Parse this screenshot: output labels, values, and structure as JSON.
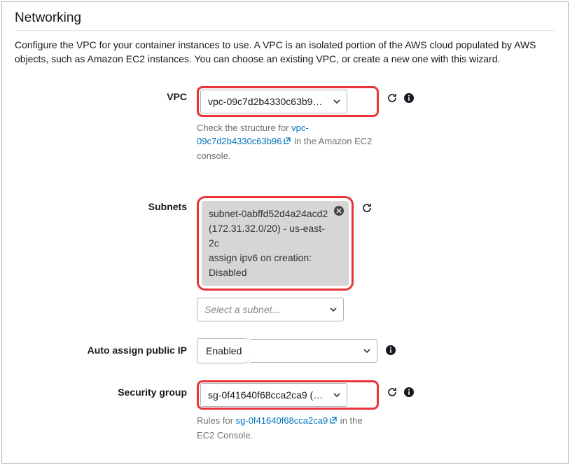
{
  "panel": {
    "title": "Networking",
    "description": "Configure the VPC for your container instances to use. A VPC is an isolated portion of the AWS cloud populated by AWS objects, such as Amazon EC2 instances. You can choose an existing VPC, or create a new one with this wizard."
  },
  "vpc": {
    "label": "VPC",
    "selected": "vpc-09c7d2b4330c63b9…",
    "hint_prefix": "Check the structure for ",
    "hint_link": "vpc-09c7d2b4330c63b96",
    "hint_suffix": " in the Amazon EC2 console."
  },
  "subnets": {
    "label": "Subnets",
    "selected": {
      "id": "subnet-0abffd52d4a24acd2",
      "cidr_az": "(172.31.32.0/20) - us-east-2c",
      "ipv6": "assign ipv6 on creation: Disabled"
    },
    "placeholder": "Select a subnet..."
  },
  "auto_ip": {
    "label": "Auto assign public IP",
    "value": "Enabled"
  },
  "sg": {
    "label": "Security group",
    "selected": "sg-0f41640f68cca2ca9 (…",
    "hint_prefix": "Rules for ",
    "hint_link": "sg-0f41640f68cca2ca9",
    "hint_suffix": " in the EC2 Console."
  }
}
